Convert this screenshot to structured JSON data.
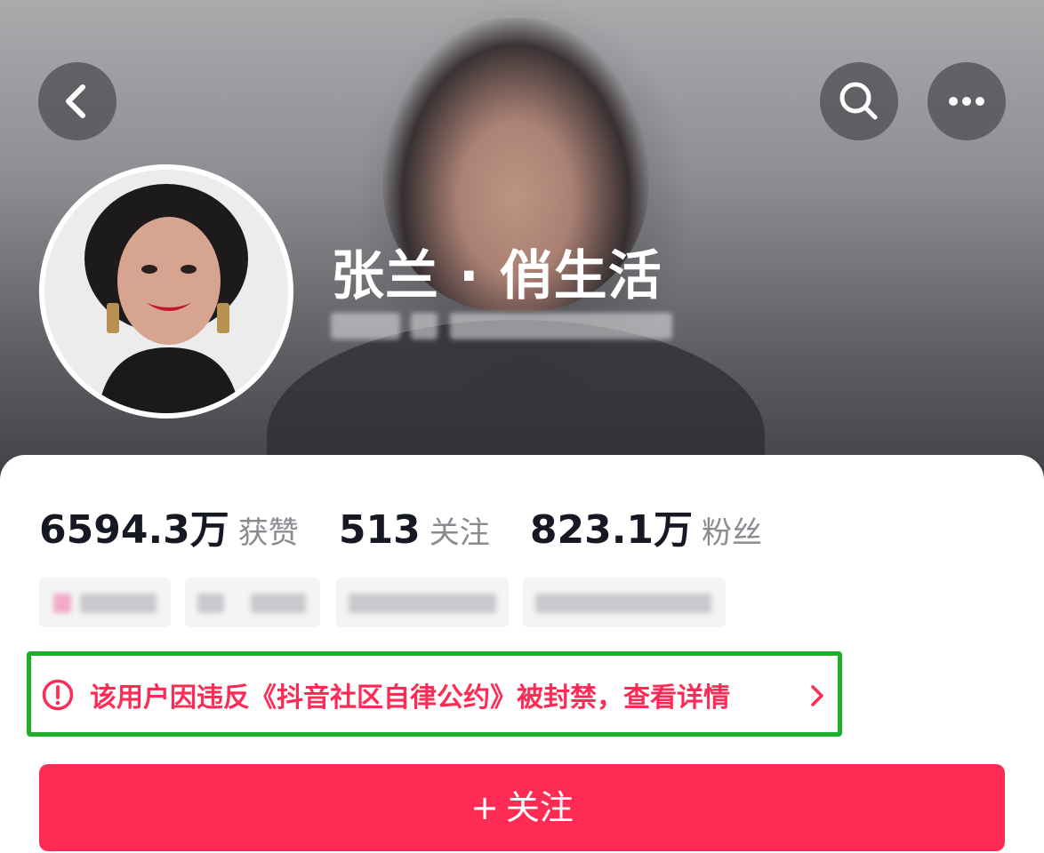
{
  "profile": {
    "username": "张兰 · 俏生活"
  },
  "stats": [
    {
      "value": "6594.3万",
      "label": "获赞"
    },
    {
      "value": "513",
      "label": "关注"
    },
    {
      "value": "823.1万",
      "label": "粉丝"
    }
  ],
  "notice": {
    "text": "该用户因违反《抖音社区自律公约》被封禁，查看详情"
  },
  "follow_button": {
    "plus": "+",
    "label": "关注"
  },
  "icons": {
    "back": "chevron-left-icon",
    "search": "search-icon",
    "more": "more-icon",
    "alert": "alert-circle-icon",
    "detail": "chevron-right-icon"
  },
  "colors": {
    "accent": "#fe2c55",
    "highlight_border": "#1fae2a",
    "stat_text": "#161823",
    "stat_label": "#8a8b91"
  }
}
